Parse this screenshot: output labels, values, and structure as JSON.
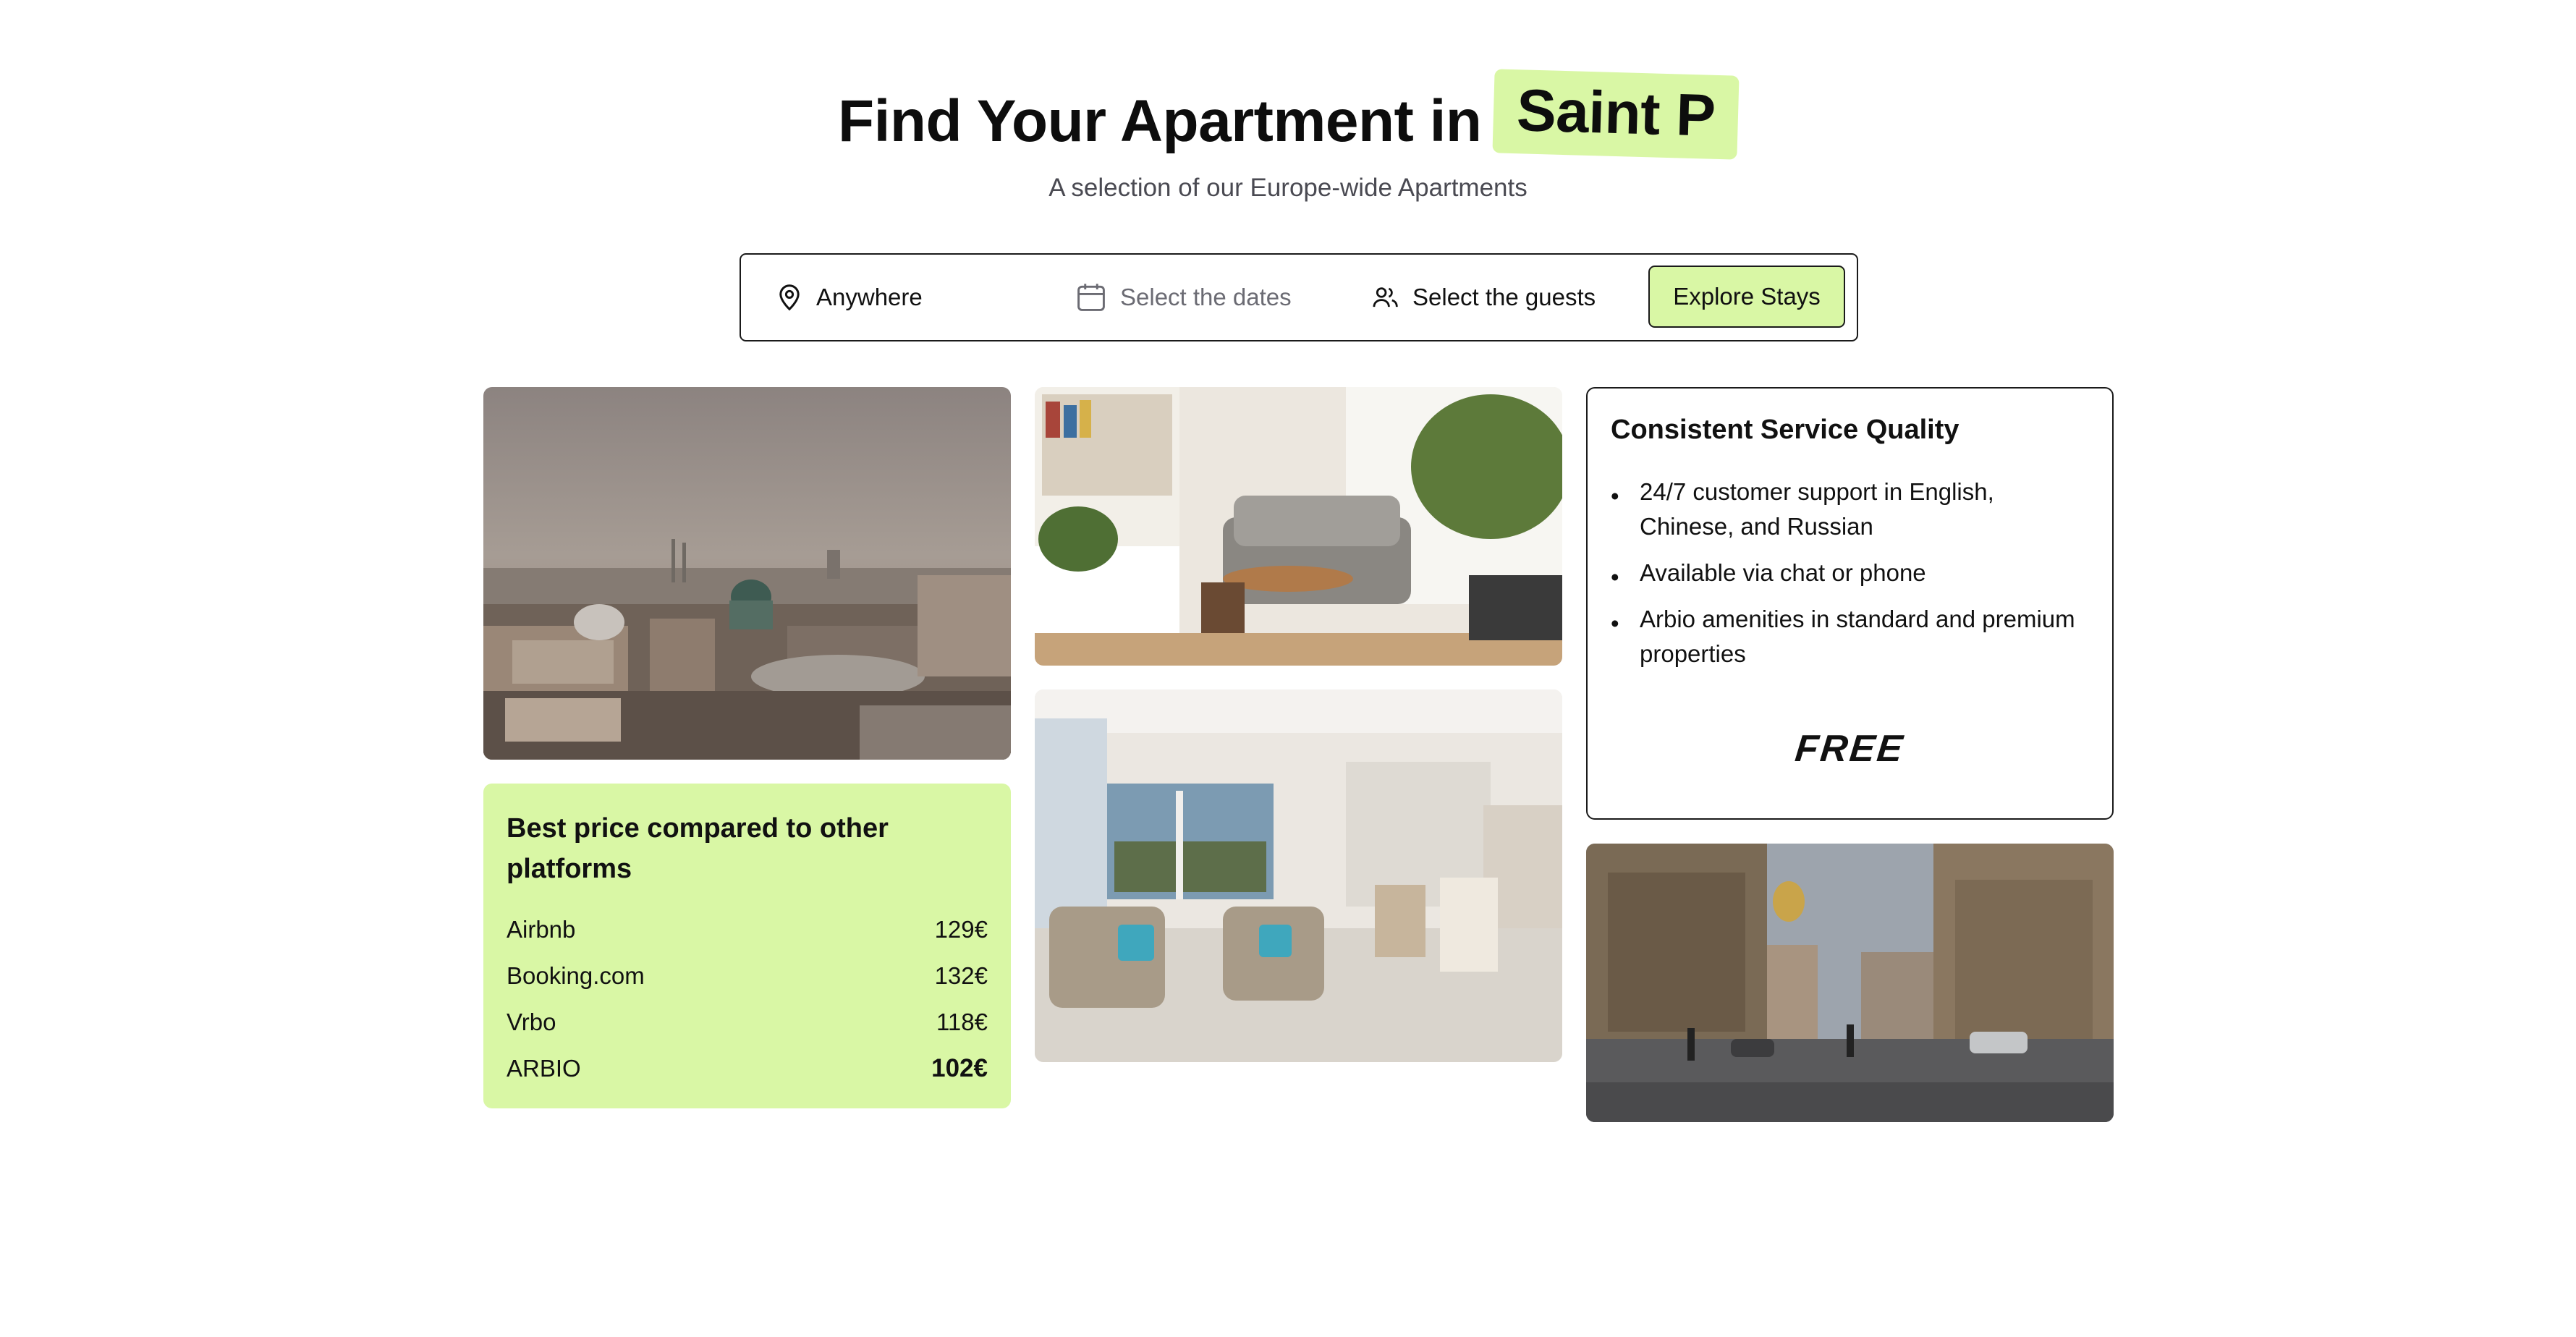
{
  "hero": {
    "title": "Find Your Apartment in",
    "city": "Saint P",
    "subtitle": "A selection of our Europe-wide Apartments"
  },
  "search": {
    "location": "Anywhere",
    "dates_placeholder": "Select the dates",
    "guests": "Select the guests",
    "explore_label": "Explore Stays"
  },
  "price_card": {
    "title": "Best price compared to other platforms",
    "rows": [
      {
        "platform": "Airbnb",
        "price": "129€"
      },
      {
        "platform": "Booking.com",
        "price": "132€"
      },
      {
        "platform": "Vrbo",
        "price": "118€"
      },
      {
        "platform": "ARBIO",
        "price": "102€"
      }
    ]
  },
  "service_card": {
    "title": "Consistent Service Quality",
    "items": [
      "24/7 customer support in English, Chinese, and Russian",
      "Available via chat or phone",
      "Arbio amenities in standard and premium properties"
    ],
    "badge": "FREE"
  },
  "icons": {
    "location": "map-pin-icon",
    "dates": "calendar-icon",
    "guests": "users-icon"
  },
  "colors": {
    "accent": "#d9f7a5",
    "border": "#1a1a1a",
    "muted_text": "#6b6b73"
  }
}
